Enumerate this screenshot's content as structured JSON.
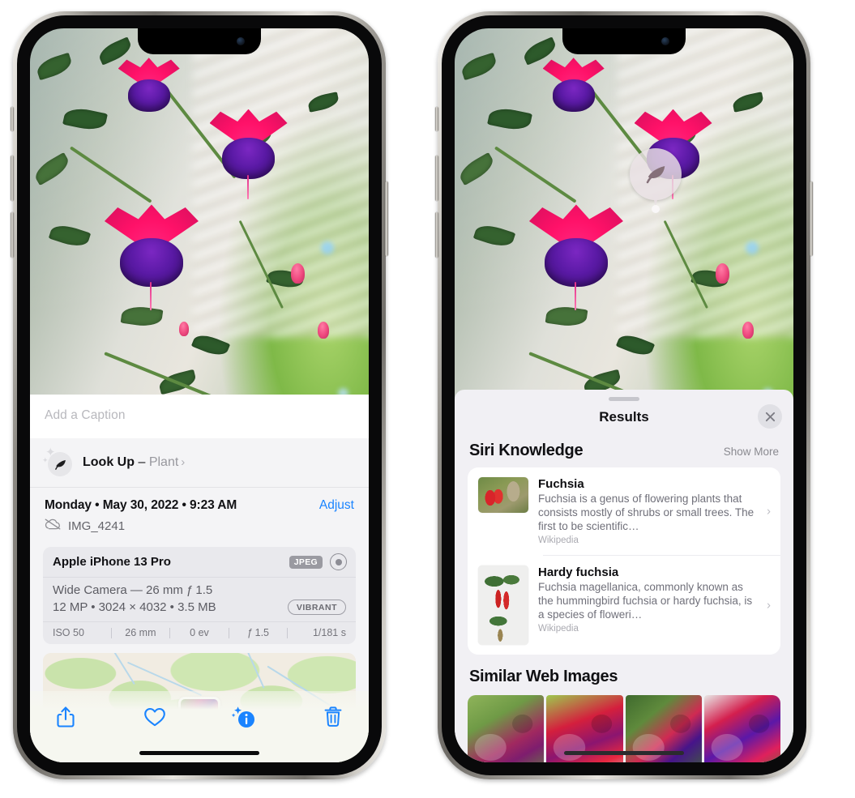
{
  "left_phone": {
    "name": "photos-detail-view",
    "caption_placeholder": "Add a Caption",
    "lookup": {
      "icon": "leaf-icon",
      "sparkle_icon": "sparkles-icon",
      "label": "Look Up",
      "dash": "–",
      "subject": "Plant",
      "chevron": "›"
    },
    "date": "Monday • May 30, 2022 • 9:23 AM",
    "adjust_label": "Adjust",
    "cloud_icon": "cloud-slash-icon",
    "file_name": "IMG_4241",
    "exif": {
      "device": "Apple iPhone 13 Pro",
      "format_badge": "JPEG",
      "raw_icon": "raw-lens-icon",
      "lens": "Wide Camera — 26 mm ƒ 1.5",
      "specs": "12 MP • 3024 × 4032 • 3.5 MB",
      "style_badge": "VIBRANT",
      "stats": [
        "ISO 50",
        "26 mm",
        "0 ev",
        "ƒ 1.5",
        "1/181 s"
      ]
    },
    "map": {
      "name": "location-map-thumbnail",
      "pin": "photo-pin"
    },
    "toolbar": [
      {
        "name": "share-button",
        "icon": "share-icon"
      },
      {
        "name": "favorite-button",
        "icon": "heart-icon"
      },
      {
        "name": "info-button",
        "icon": "info-sparkle-icon",
        "active": true
      },
      {
        "name": "delete-button",
        "icon": "trash-icon"
      }
    ],
    "accent_color": "#1a84ff"
  },
  "right_phone": {
    "name": "visual-look-up-results",
    "badge": {
      "icon": "leaf-icon",
      "name": "visual-look-up-badge"
    },
    "sheet": {
      "grabber": "drag-handle",
      "title": "Results",
      "close_icon": "close-icon"
    },
    "siri_knowledge": {
      "title": "Siri Knowledge",
      "action": "Show More",
      "items": [
        {
          "title": "Fuchsia",
          "snippet": "Fuchsia is a genus of flowering plants that consists mostly of shrubs or small trees. The first to be scientific…",
          "source": "Wikipedia",
          "thumbnail": "fuchsia-red-flowers-thumbnail",
          "chevron": "›"
        },
        {
          "title": "Hardy fuchsia",
          "snippet": "Fuchsia magellanica, commonly known as the hummingbird fuchsia or hardy fuchsia, is a species of floweri…",
          "source": "Wikipedia",
          "thumbnail": "hardy-fuchsia-specimen-thumbnail",
          "chevron": "›"
        }
      ]
    },
    "similar_web_images": {
      "title": "Similar Web Images",
      "items": [
        "pink-white-fuchsia-thumbnail",
        "red-fuchsia-closeup-thumbnail",
        "fuchsia-shrub-thumbnail",
        "purple-red-fuchsia-thumbnail"
      ]
    }
  }
}
